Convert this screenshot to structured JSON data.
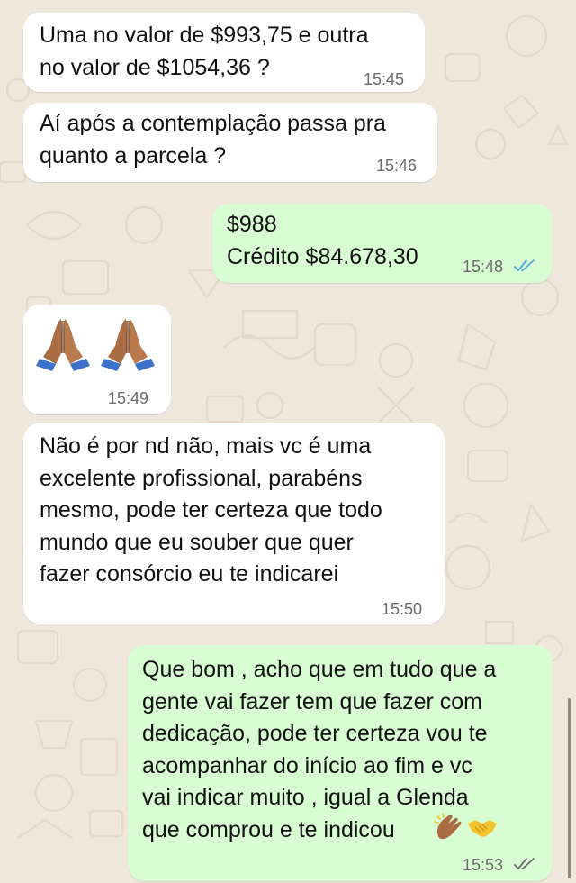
{
  "colors": {
    "wallpaper": "#efe7dc",
    "incoming_bubble": "#ffffff",
    "outgoing_bubble": "#d9fdd3",
    "read_ticks": "#4fa6e0",
    "delivered_ticks": "#6b6b6b"
  },
  "messages": [
    {
      "direction": "incoming",
      "text": "Uma no valor de $993,75 e outra\nno valor de $1054,36 ?",
      "time": "15:45"
    },
    {
      "direction": "incoming",
      "text": "Aí após a contemplação passa pra\nquanto a parcela ?",
      "time": "15:46"
    },
    {
      "direction": "outgoing",
      "text": "$988\nCrédito $84.678,30",
      "time": "15:48",
      "status_icon": "double-check-read-icon"
    },
    {
      "direction": "incoming",
      "emoji": [
        "folded-hands-icon",
        "folded-hands-icon"
      ],
      "time": "15:49"
    },
    {
      "direction": "incoming",
      "text": "Não é por nd não, mais vc é uma\nexcelente profissional, parabéns\nmesmo, pode ter certeza que todo\nmundo que eu souber que quer\nfazer consórcio eu te indicarei",
      "time": "15:50"
    },
    {
      "direction": "outgoing",
      "text": "Que bom , acho que em tudo que a\ngente vai fazer tem que fazer com\ndedicação, pode ter certeza vou te\nacompanhar do início ao fim e vc\nvai indicar muito , igual a Glenda\nque comprou e te indicou",
      "trailing_emoji": [
        "clapping-hands-icon",
        "handshake-icon"
      ],
      "time": "15:53",
      "status_icon": "double-check-delivered-icon"
    }
  ]
}
